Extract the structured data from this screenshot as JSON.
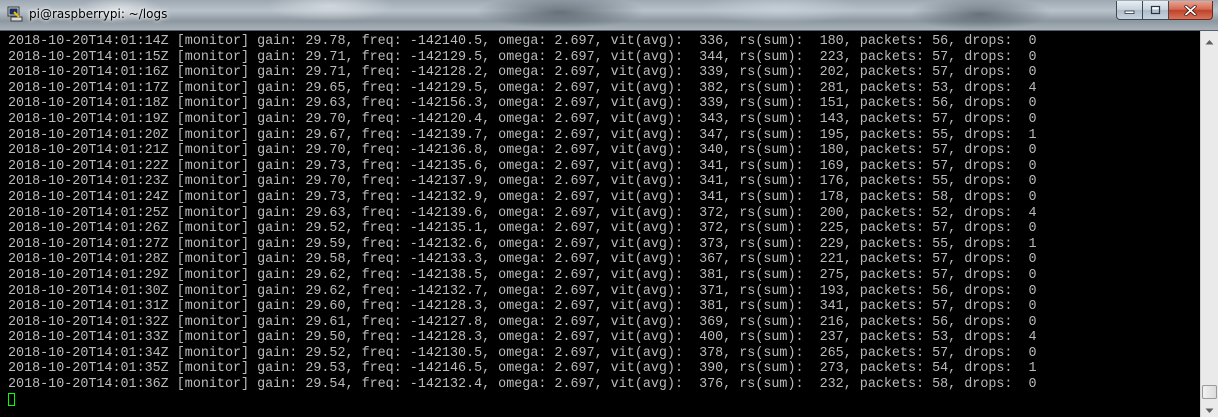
{
  "window": {
    "title": "pi@raspberrypi: ~/logs",
    "icon": "putty-terminal-icon",
    "controls": {
      "minimize_icon": "minimize-icon",
      "maximize_icon": "maximize-icon",
      "close_icon": "close-icon"
    }
  },
  "terminal": {
    "text_color": "#bbbbbb",
    "background": "#000000",
    "cursor_color": "#00ff00",
    "lines": [
      "2018-10-20T14:01:14Z [monitor] gain: 29.78, freq: -142140.5, omega: 2.697, vit(avg):  336, rs(sum):  180, packets: 56, drops:  0",
      "2018-10-20T14:01:15Z [monitor] gain: 29.71, freq: -142129.5, omega: 2.697, vit(avg):  344, rs(sum):  223, packets: 57, drops:  0",
      "2018-10-20T14:01:16Z [monitor] gain: 29.71, freq: -142128.2, omega: 2.697, vit(avg):  339, rs(sum):  202, packets: 57, drops:  0",
      "2018-10-20T14:01:17Z [monitor] gain: 29.65, freq: -142129.5, omega: 2.697, vit(avg):  382, rs(sum):  281, packets: 53, drops:  4",
      "2018-10-20T14:01:18Z [monitor] gain: 29.63, freq: -142156.3, omega: 2.697, vit(avg):  339, rs(sum):  151, packets: 56, drops:  0",
      "2018-10-20T14:01:19Z [monitor] gain: 29.70, freq: -142120.4, omega: 2.697, vit(avg):  343, rs(sum):  143, packets: 57, drops:  0",
      "2018-10-20T14:01:20Z [monitor] gain: 29.67, freq: -142139.7, omega: 2.697, vit(avg):  347, rs(sum):  195, packets: 55, drops:  1",
      "2018-10-20T14:01:21Z [monitor] gain: 29.70, freq: -142136.8, omega: 2.697, vit(avg):  340, rs(sum):  180, packets: 57, drops:  0",
      "2018-10-20T14:01:22Z [monitor] gain: 29.73, freq: -142135.6, omega: 2.697, vit(avg):  341, rs(sum):  169, packets: 57, drops:  0",
      "2018-10-20T14:01:23Z [monitor] gain: 29.70, freq: -142137.9, omega: 2.697, vit(avg):  341, rs(sum):  176, packets: 55, drops:  0",
      "2018-10-20T14:01:24Z [monitor] gain: 29.73, freq: -142132.9, omega: 2.697, vit(avg):  341, rs(sum):  178, packets: 58, drops:  0",
      "2018-10-20T14:01:25Z [monitor] gain: 29.63, freq: -142139.6, omega: 2.697, vit(avg):  372, rs(sum):  200, packets: 52, drops:  4",
      "2018-10-20T14:01:26Z [monitor] gain: 29.52, freq: -142135.1, omega: 2.697, vit(avg):  372, rs(sum):  225, packets: 57, drops:  0",
      "2018-10-20T14:01:27Z [monitor] gain: 29.59, freq: -142132.6, omega: 2.697, vit(avg):  373, rs(sum):  229, packets: 55, drops:  1",
      "2018-10-20T14:01:28Z [monitor] gain: 29.58, freq: -142133.3, omega: 2.697, vit(avg):  367, rs(sum):  221, packets: 57, drops:  0",
      "2018-10-20T14:01:29Z [monitor] gain: 29.62, freq: -142138.5, omega: 2.697, vit(avg):  381, rs(sum):  275, packets: 57, drops:  0",
      "2018-10-20T14:01:30Z [monitor] gain: 29.62, freq: -142132.7, omega: 2.697, vit(avg):  371, rs(sum):  193, packets: 56, drops:  0",
      "2018-10-20T14:01:31Z [monitor] gain: 29.60, freq: -142128.3, omega: 2.697, vit(avg):  381, rs(sum):  341, packets: 57, drops:  0",
      "2018-10-20T14:01:32Z [monitor] gain: 29.61, freq: -142127.8, omega: 2.697, vit(avg):  369, rs(sum):  216, packets: 56, drops:  0",
      "2018-10-20T14:01:33Z [monitor] gain: 29.50, freq: -142128.3, omega: 2.697, vit(avg):  400, rs(sum):  237, packets: 53, drops:  4",
      "2018-10-20T14:01:34Z [monitor] gain: 29.52, freq: -142130.5, omega: 2.697, vit(avg):  378, rs(sum):  265, packets: 57, drops:  0",
      "2018-10-20T14:01:35Z [monitor] gain: 29.53, freq: -142146.5, omega: 2.697, vit(avg):  390, rs(sum):  273, packets: 54, drops:  1",
      "2018-10-20T14:01:36Z [monitor] gain: 29.54, freq: -142132.4, omega: 2.697, vit(avg):  376, rs(sum):  232, packets: 58, drops:  0"
    ]
  },
  "scrollbar": {
    "up_icon": "scroll-up-arrow-icon",
    "down_icon": "scroll-down-arrow-icon",
    "position": "bottom"
  }
}
